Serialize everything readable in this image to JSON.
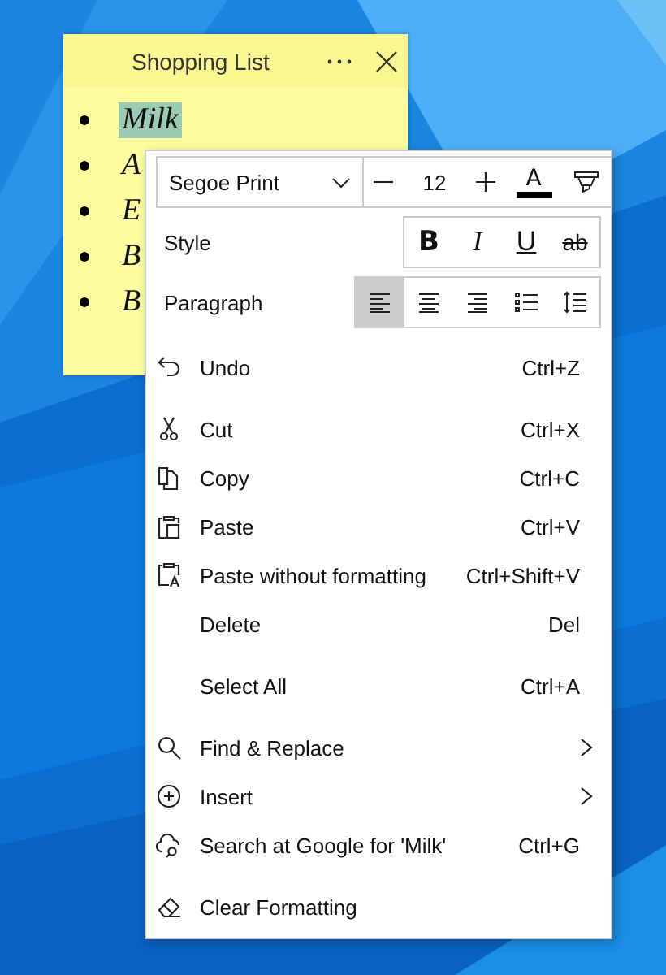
{
  "note": {
    "title": "Shopping List",
    "items": [
      {
        "text": "Milk",
        "selected": true
      },
      {
        "text": "A",
        "selected": false
      },
      {
        "text": "E",
        "selected": false
      },
      {
        "text": "B",
        "selected": false
      },
      {
        "text": "B",
        "selected": false
      }
    ]
  },
  "format_bar": {
    "font": "Segoe Print",
    "size": "12",
    "font_color_label": "A",
    "style_label": "Style",
    "styles": [
      {
        "kind": "bold",
        "label": "B",
        "selected": false
      },
      {
        "kind": "italic",
        "label": "I",
        "selected": false
      },
      {
        "kind": "underline",
        "label": "U",
        "selected": false
      },
      {
        "kind": "strike",
        "label": "ab",
        "selected": false
      }
    ],
    "paragraph_label": "Paragraph",
    "paragraph": [
      {
        "kind": "left",
        "selected": true
      },
      {
        "kind": "center",
        "selected": false
      },
      {
        "kind": "right",
        "selected": false
      },
      {
        "kind": "bullets",
        "selected": false
      },
      {
        "kind": "spacing",
        "selected": false
      }
    ]
  },
  "menu": [
    [
      {
        "label": "Undo",
        "shortcut": "Ctrl+Z",
        "kind": "undo",
        "submenu": false
      }
    ],
    [
      {
        "label": "Cut",
        "shortcut": "Ctrl+X",
        "kind": "cut",
        "submenu": false
      },
      {
        "label": "Copy",
        "shortcut": "Ctrl+C",
        "kind": "copy",
        "submenu": false
      },
      {
        "label": "Paste",
        "shortcut": "Ctrl+V",
        "kind": "paste",
        "submenu": false
      },
      {
        "label": "Paste without formatting",
        "shortcut": "Ctrl+Shift+V",
        "kind": "paste-plain",
        "submenu": false
      },
      {
        "label": "Delete",
        "shortcut": "Del",
        "kind": "plain",
        "submenu": false
      }
    ],
    [
      {
        "label": "Select All",
        "shortcut": "Ctrl+A",
        "kind": "plain",
        "submenu": false
      }
    ],
    [
      {
        "label": "Find & Replace",
        "kind": "search",
        "submenu": true
      },
      {
        "label": "Insert",
        "kind": "insert",
        "submenu": true
      },
      {
        "label": "Search at Google for 'Milk'",
        "shortcut": "Ctrl+G",
        "kind": "web-search",
        "submenu": false
      }
    ],
    [
      {
        "label": "Clear Formatting",
        "kind": "eraser",
        "submenu": false
      }
    ]
  ]
}
